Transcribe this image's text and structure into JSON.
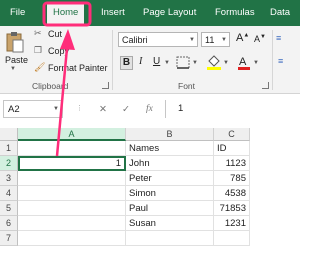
{
  "ribbon_tabs": [
    {
      "label": "File"
    },
    {
      "label": "Home"
    },
    {
      "label": "Insert"
    },
    {
      "label": "Page Layout"
    },
    {
      "label": "Formulas"
    },
    {
      "label": "Data"
    }
  ],
  "clipboard": {
    "paste_label": "Paste",
    "cut_label": "Cut",
    "copy_label": "Copy",
    "format_painter_label": "Format Painter",
    "group_label": "Clipboard"
  },
  "font_group": {
    "font_name": "Calibri",
    "font_size": "11",
    "bold": "B",
    "italic": "I",
    "underline": "U",
    "group_label": "Font"
  },
  "formula_bar": {
    "name_box": "A2",
    "cancel": "✕",
    "enter": "✓",
    "fx": "fx",
    "value": "1"
  },
  "grid": {
    "columns": [
      "A",
      "B",
      "C"
    ],
    "rows": [
      {
        "num": "1",
        "a": "",
        "b": "Names",
        "c": "ID"
      },
      {
        "num": "2",
        "a": "1",
        "b": "John",
        "c": "1123"
      },
      {
        "num": "3",
        "a": "",
        "b": "Peter",
        "c": "785"
      },
      {
        "num": "4",
        "a": "",
        "b": "Simon",
        "c": "4538"
      },
      {
        "num": "5",
        "a": "",
        "b": "Paul",
        "c": "71853"
      },
      {
        "num": "6",
        "a": "",
        "b": "Susan",
        "c": "1231"
      },
      {
        "num": "7",
        "a": "",
        "b": "",
        "c": ""
      }
    ]
  },
  "colors": {
    "ribbon_green": "#217346",
    "highlight_pink": "#ff2d7a"
  },
  "icons": [
    "paste-icon",
    "cut-icon",
    "copy-icon",
    "format-painter-icon",
    "name-box-dropdown-icon",
    "font-color-icon",
    "fill-color-icon",
    "borders-icon"
  ]
}
